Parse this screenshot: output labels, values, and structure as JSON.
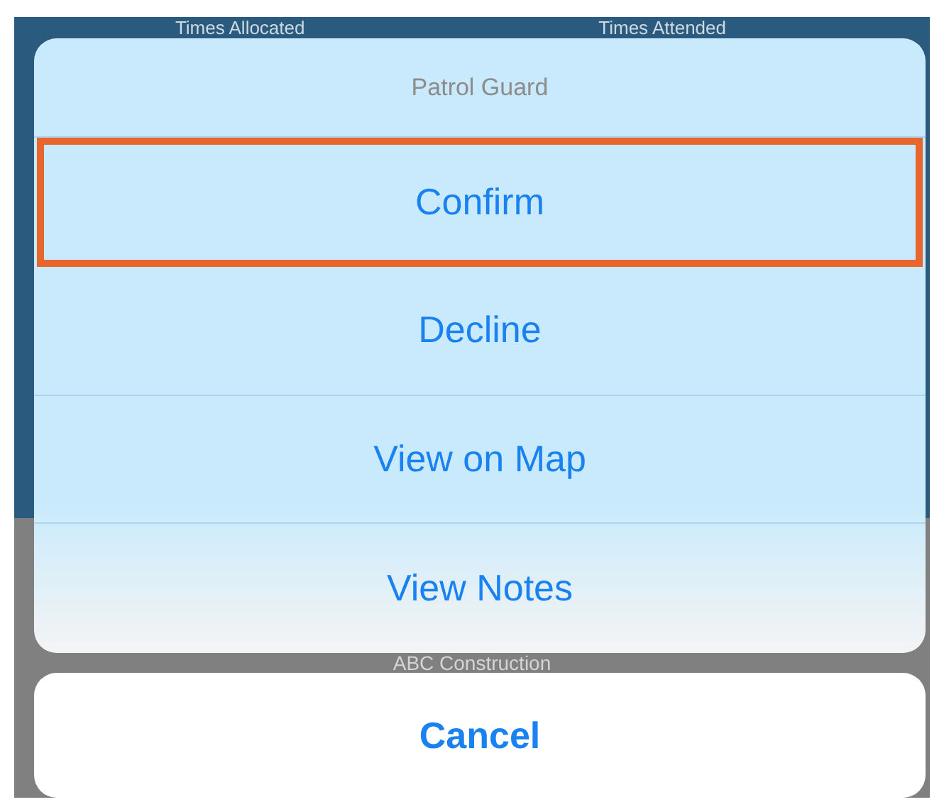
{
  "background": {
    "column_headers": [
      "Times Allocated",
      "Times Attended"
    ],
    "company": "ABC Construction"
  },
  "action_sheet": {
    "title": "Patrol Guard",
    "actions": [
      {
        "label": "Confirm",
        "highlighted": true
      },
      {
        "label": "Decline",
        "highlighted": false
      },
      {
        "label": "View on Map",
        "highlighted": false
      },
      {
        "label": "View Notes",
        "highlighted": false
      }
    ],
    "cancel": "Cancel"
  }
}
